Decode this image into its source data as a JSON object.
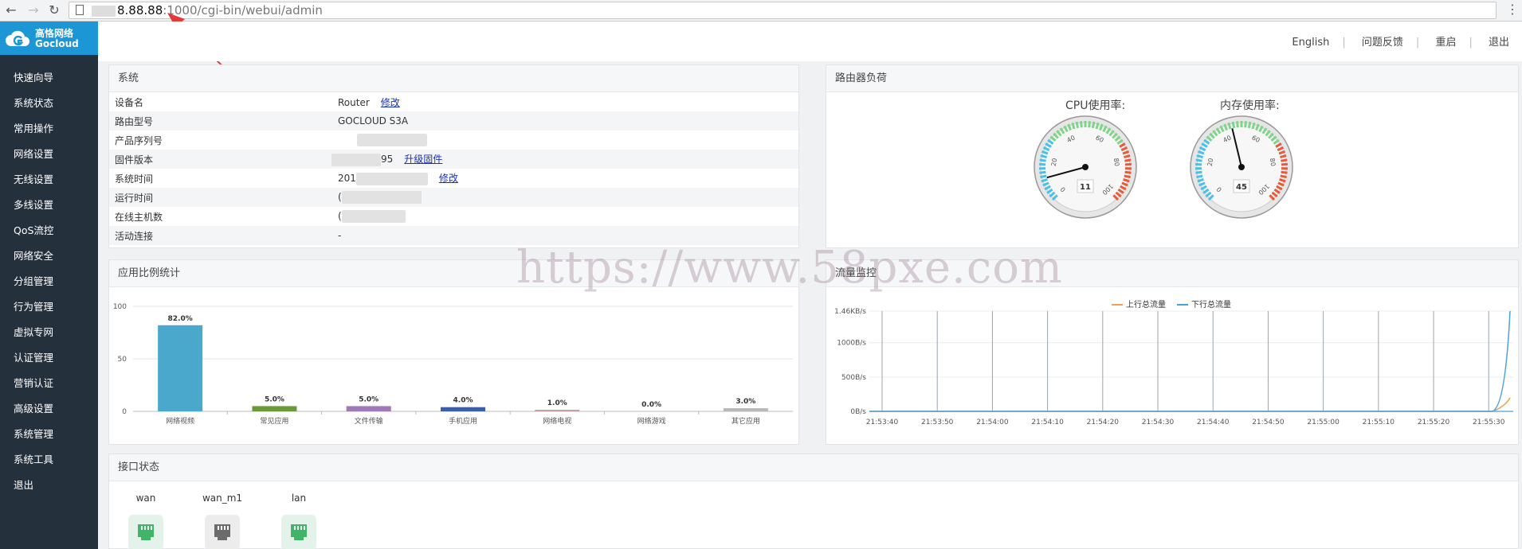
{
  "browser": {
    "url_host": "8.88.88",
    "url_rest": ":1000/cgi-bin/webui/admin"
  },
  "logo": {
    "cn": "高恪网络",
    "en": "Gocloud"
  },
  "sidebar": {
    "items": [
      {
        "label": "快速向导"
      },
      {
        "label": "系统状态"
      },
      {
        "label": "常用操作"
      },
      {
        "label": "网络设置"
      },
      {
        "label": "无线设置"
      },
      {
        "label": "多线设置"
      },
      {
        "label": "QoS流控"
      },
      {
        "label": "网络安全"
      },
      {
        "label": "分组管理"
      },
      {
        "label": "行为管理"
      },
      {
        "label": "虚拟专网"
      },
      {
        "label": "认证管理"
      },
      {
        "label": "营销认证"
      },
      {
        "label": "高级设置"
      },
      {
        "label": "系统管理"
      },
      {
        "label": "系统工具"
      },
      {
        "label": "退出"
      }
    ]
  },
  "header": {
    "links": [
      {
        "label": "English"
      },
      {
        "label": "问题反馈"
      },
      {
        "label": "重启"
      },
      {
        "label": "退出"
      }
    ]
  },
  "system": {
    "title": "系统",
    "rows": [
      {
        "label": "设备名",
        "value": "Router",
        "link": "修改"
      },
      {
        "label": "路由型号",
        "value": "GOCLOUD S3A"
      },
      {
        "label": "产品序列号",
        "value": ""
      },
      {
        "label": "固件版本",
        "value": "95",
        "link": "升级固件"
      },
      {
        "label": "系统时间",
        "value": "201",
        "link": "修改"
      },
      {
        "label": "运行时间",
        "value": "("
      },
      {
        "label": "在线主机数",
        "value": "("
      },
      {
        "label": "活动连接",
        "value": "-"
      }
    ]
  },
  "load": {
    "title": "路由器负荷",
    "cpu": {
      "title": "CPU使用率:",
      "value": 11
    },
    "mem": {
      "title": "内存使用率:",
      "value": 45
    },
    "ticks": [
      "0",
      "20",
      "40",
      "60",
      "80",
      "100"
    ]
  },
  "app_stats": {
    "title": "应用比例统计",
    "chart_data": {
      "type": "bar",
      "categories": [
        "网络视频",
        "常见应用",
        "文件传输",
        "手机应用",
        "网络电视",
        "网络游戏",
        "其它应用"
      ],
      "values": [
        82.0,
        5.0,
        5.0,
        4.0,
        1.0,
        0.0,
        3.0
      ],
      "value_labels": [
        "82.0%",
        "5.0%",
        "5.0%",
        "4.0%",
        "1.0%",
        "0.0%",
        "3.0%"
      ],
      "colors": [
        "#4aa8cc",
        "#6a9a3a",
        "#a07ab8",
        "#3a5ea8",
        "#c8a0a0",
        "#999999",
        "#b8b8b8"
      ],
      "yticks": [
        "0",
        "50",
        "100"
      ],
      "ylim": [
        0,
        100
      ]
    }
  },
  "traffic": {
    "title": "流量监控",
    "chart_data": {
      "type": "line",
      "x": [
        "21:53:40",
        "21:53:50",
        "21:54:00",
        "21:54:10",
        "21:54:20",
        "21:54:30",
        "21:54:40",
        "21:54:50",
        "21:55:00",
        "21:55:10",
        "21:55:20",
        "21:55:30"
      ],
      "yticks": [
        "0B/s",
        "500B/s",
        "1000B/s",
        "1.46KB/s"
      ],
      "series": [
        {
          "name": "上行总流量",
          "color": "#f0a050",
          "end_value_bps": 200
        },
        {
          "name": "下行总流量",
          "color": "#4aa0d8",
          "end_value_bps": 1460
        }
      ]
    }
  },
  "interfaces": {
    "title": "接口状态",
    "items": [
      {
        "name": "wan",
        "status": "up"
      },
      {
        "name": "wan_m1",
        "status": "down"
      },
      {
        "name": "lan",
        "status": "up"
      }
    ]
  },
  "watermark": "https://www.58pxe.com"
}
